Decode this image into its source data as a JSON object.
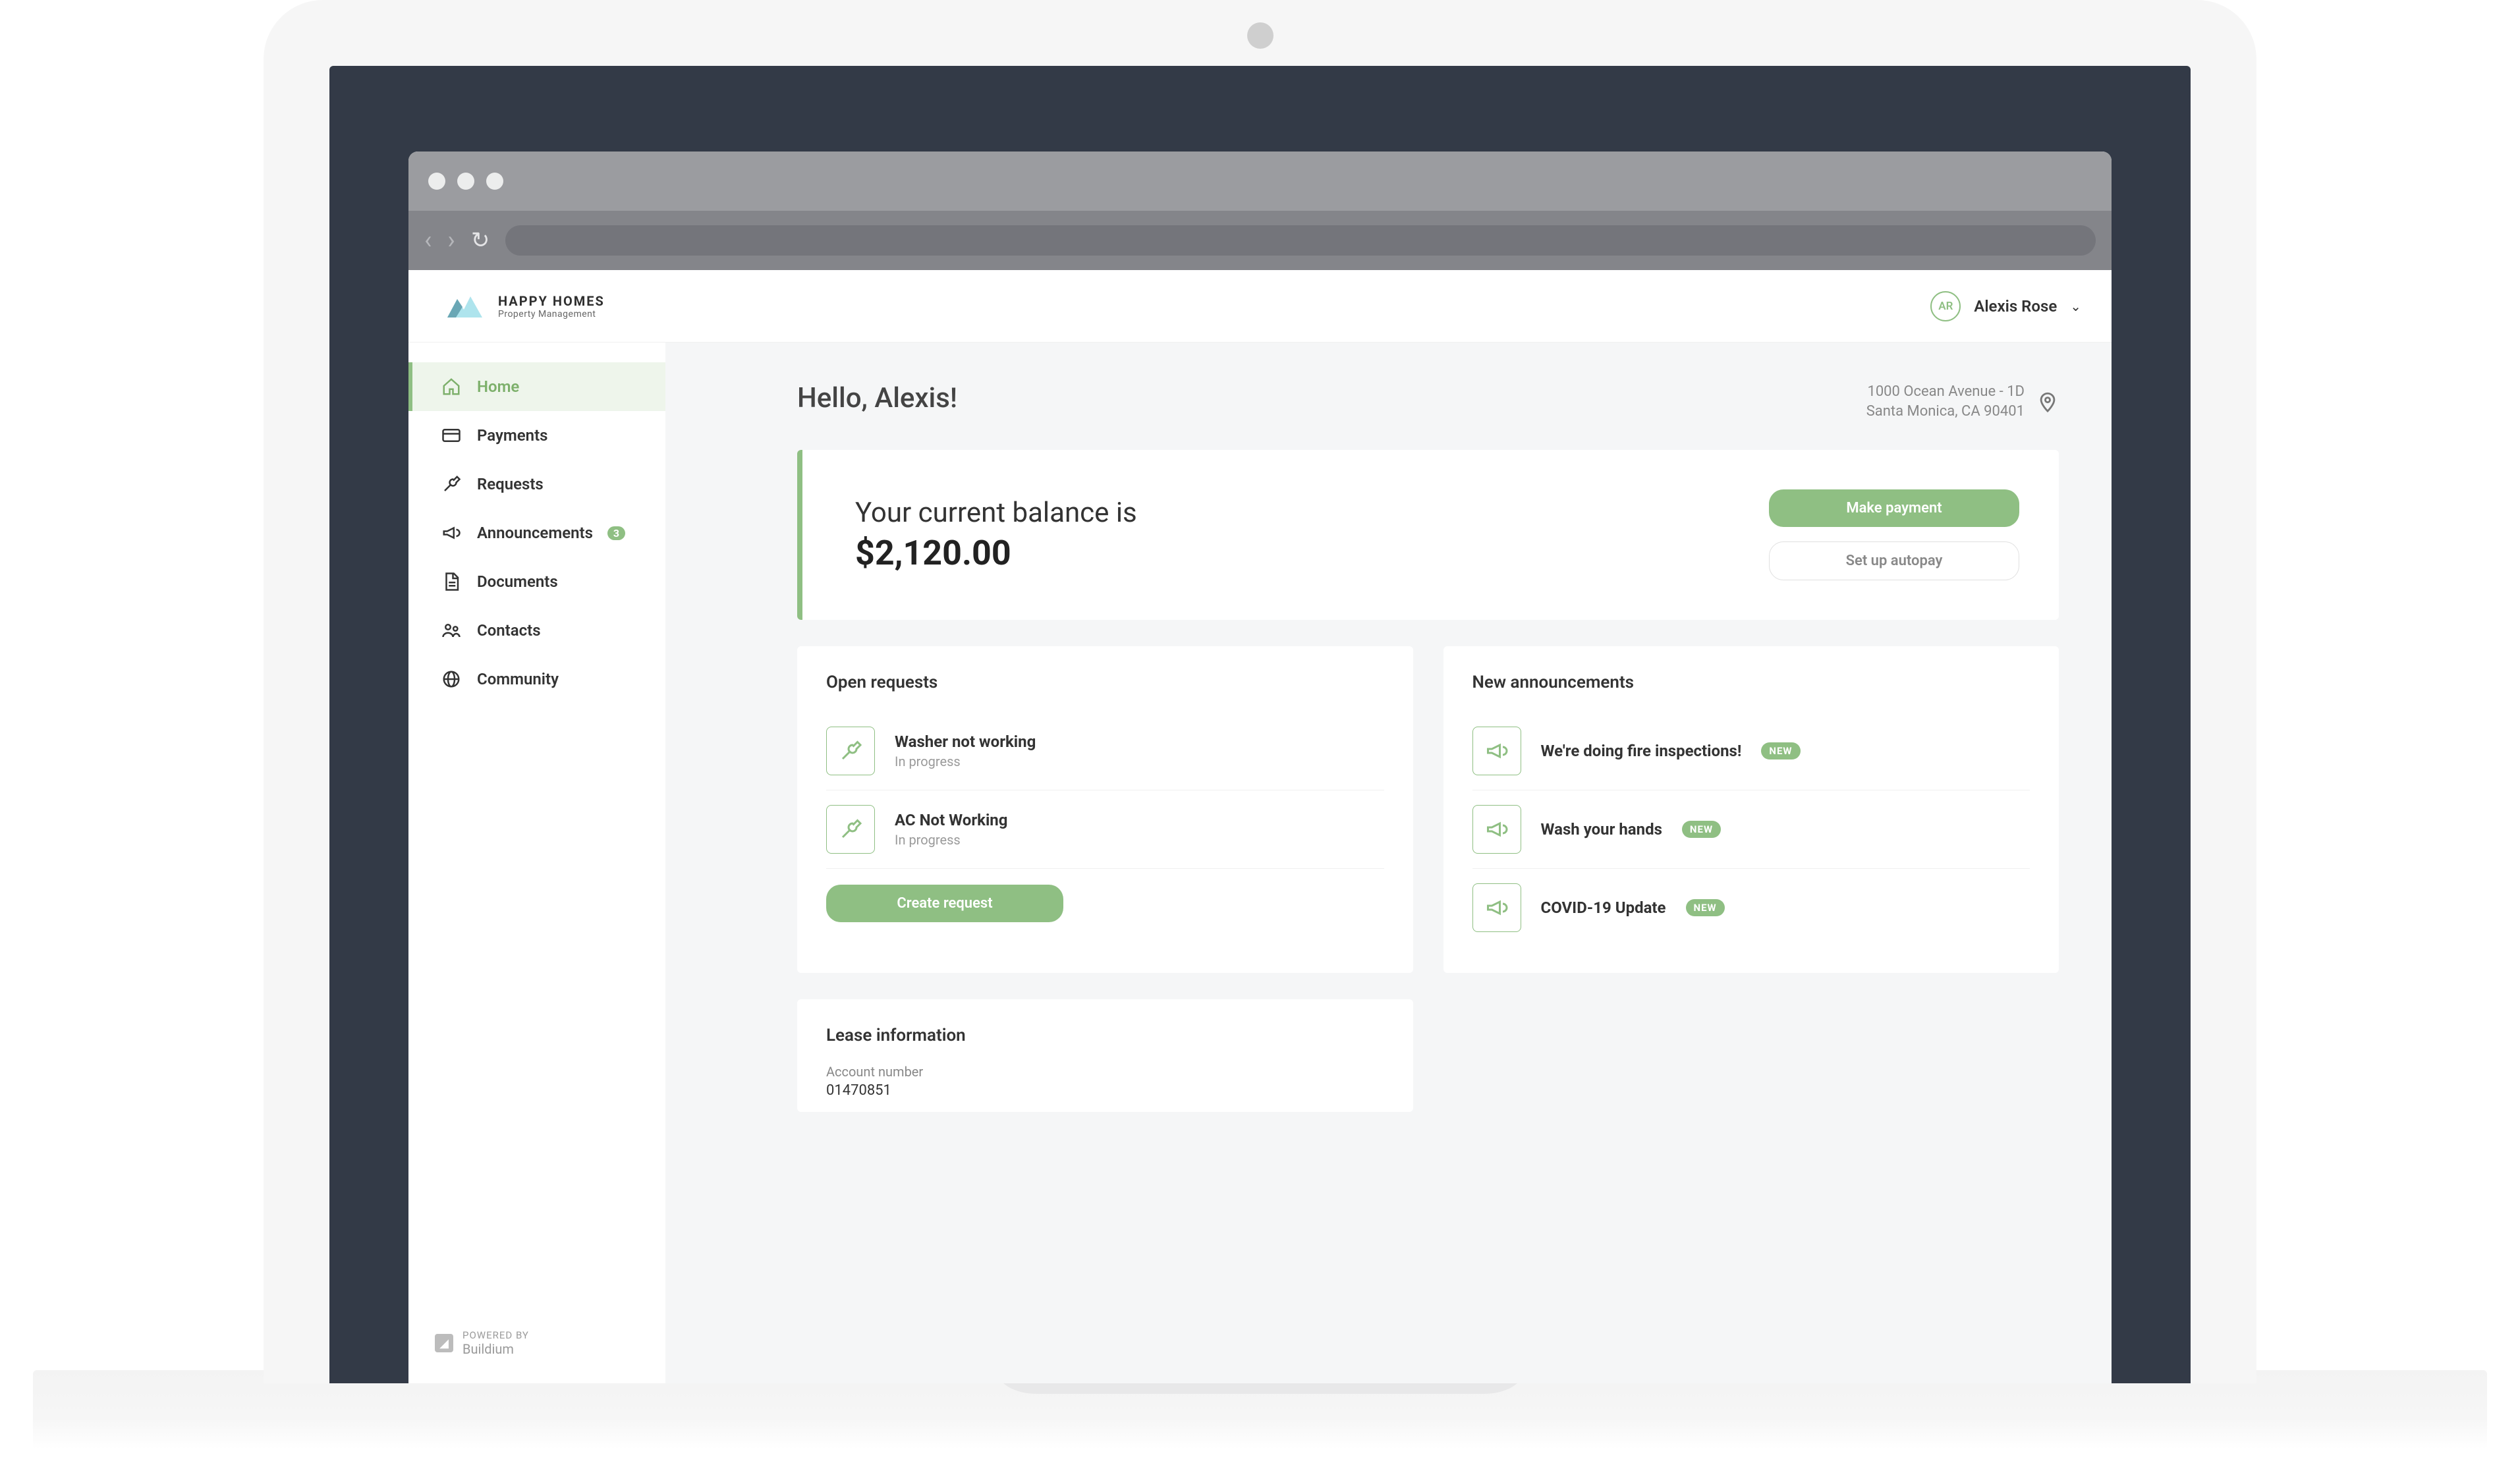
{
  "brand": {
    "name": "HAPPY HOMES",
    "tagline": "Property Management"
  },
  "user": {
    "initials": "AR",
    "name": "Alexis Rose"
  },
  "sidebar": {
    "items": [
      {
        "label": "Home"
      },
      {
        "label": "Payments"
      },
      {
        "label": "Requests"
      },
      {
        "label": "Announcements",
        "badge": "3"
      },
      {
        "label": "Documents"
      },
      {
        "label": "Contacts"
      },
      {
        "label": "Community"
      }
    ],
    "footer_powered": "POWERED BY",
    "footer_name": "Buildium"
  },
  "greeting": "Hello, Alexis!",
  "address": {
    "line1": "1000 Ocean Avenue - 1D",
    "line2": "Santa Monica, CA 90401"
  },
  "balance": {
    "label": "Your current balance is",
    "amount": "$2,120.00",
    "make_payment": "Make payment",
    "setup_autopay": "Set up autopay"
  },
  "open_requests": {
    "title": "Open requests",
    "items": [
      {
        "title": "Washer not working",
        "status": "In progress"
      },
      {
        "title": "AC Not Working",
        "status": "In progress"
      }
    ],
    "create_label": "Create request"
  },
  "announcements": {
    "title": "New announcements",
    "new_label": "NEW",
    "items": [
      {
        "title": "We're doing fire inspections!"
      },
      {
        "title": "Wash your hands"
      },
      {
        "title": "COVID-19 Update"
      }
    ]
  },
  "lease": {
    "title": "Lease information",
    "account_label": "Account number",
    "account_value": "01470851"
  }
}
